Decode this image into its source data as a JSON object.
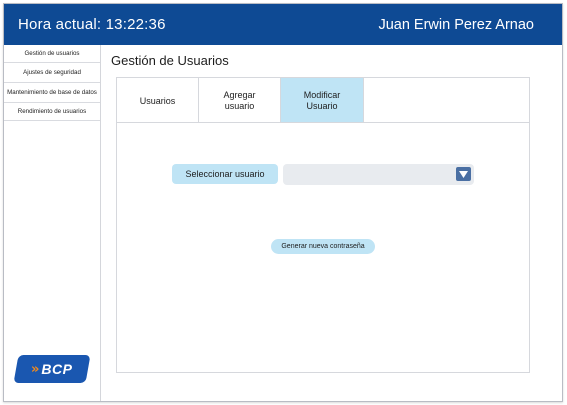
{
  "header": {
    "clock": "Hora actual: 13:22:36",
    "user_name": "Juan Erwin Perez Arnao",
    "brand_color": "#0e4a94"
  },
  "sidebar": {
    "items": [
      {
        "label": "Gestión de usuarios"
      },
      {
        "label": "Ajustes de seguridad"
      },
      {
        "label": "Mantenimiento de base de datos"
      },
      {
        "label": "Rendimiento de usuarios"
      }
    ],
    "logo": {
      "text": "BCP",
      "mark": "arrow-icon",
      "color": "#1a57b0",
      "accent": "#f28a1c"
    }
  },
  "main": {
    "title": "Gestión de Usuarios",
    "tabs": [
      {
        "label": "Usuarios",
        "active": false
      },
      {
        "label": "Agregar usuario",
        "active": false
      },
      {
        "label": "Modificar Usuario",
        "active": true
      }
    ],
    "select_user": {
      "label": "Seleccionar usuario",
      "value": "",
      "dropdown_icon": "chevron-down-icon"
    },
    "generate_password_label": "Generar nueva contraseña",
    "accent_light": "#bfe4f5"
  }
}
